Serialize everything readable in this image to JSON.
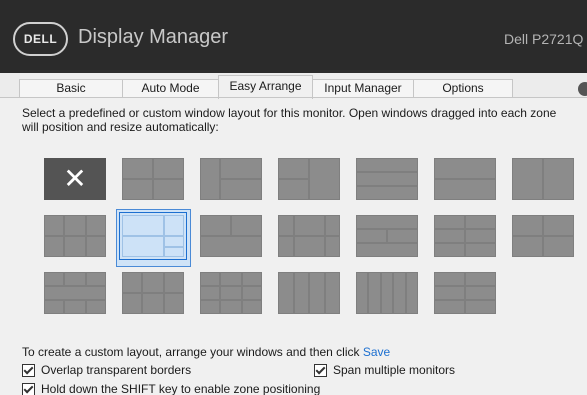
{
  "header": {
    "logo_text": "DELL",
    "title": "Display Manager",
    "monitor": "Dell P2721Q"
  },
  "tabs": [
    {
      "label": "Basic",
      "active": false
    },
    {
      "label": "Auto Mode",
      "active": false
    },
    {
      "label": "Easy Arrange",
      "active": true
    },
    {
      "label": "Input Manager",
      "active": false
    },
    {
      "label": "Options",
      "active": false
    }
  ],
  "description": "Select a predefined or custom window layout for this monitor.  Open windows dragged into each zone will position and resize automatically:",
  "layouts": {
    "blank_symbol": "✕",
    "selected_index": 8,
    "count": 20
  },
  "footer": {
    "custom_text": "To create a custom layout, arrange your windows and then click",
    "save_label": "Save",
    "overlap_label": "Overlap transparent borders",
    "span_label": "Span multiple monitors",
    "shift_label": "Hold down the SHIFT key to enable zone positioning"
  },
  "checks": {
    "overlap": true,
    "span": true,
    "shift": true
  },
  "colors": {
    "titlebar": "#2b2b2b",
    "accent": "#1c6fd0",
    "selection": "#cde2f7"
  }
}
